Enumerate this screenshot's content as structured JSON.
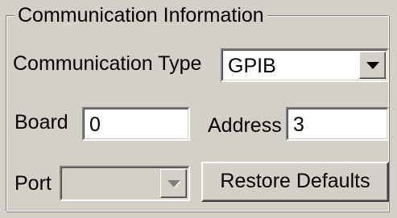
{
  "group": {
    "title": "Communication Information"
  },
  "comm_type": {
    "label": "Communication Type",
    "selected": "GPIB",
    "dropdown_icon": "chevron-down-icon"
  },
  "board": {
    "label": "Board",
    "value": "0"
  },
  "address": {
    "label": "Address",
    "value": "3"
  },
  "port": {
    "label": "Port",
    "selected": "",
    "disabled": true,
    "dropdown_icon": "chevron-down-icon"
  },
  "buttons": {
    "restore_defaults": "Restore Defaults"
  },
  "colors": {
    "face": "#d4d0c8",
    "field": "#ffffff",
    "shadow": "#808080",
    "dark_shadow": "#404040",
    "highlight": "#ffffff"
  }
}
